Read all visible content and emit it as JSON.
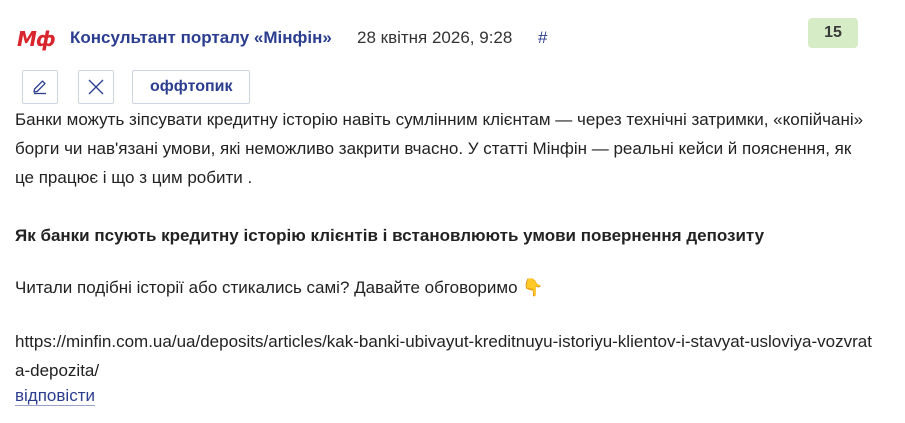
{
  "comment": {
    "logo_text": "Мф",
    "author": "Консультант порталу «Мінфін»",
    "date": "28 квітня 2026, 9:28",
    "anchor": "#",
    "rating": "15",
    "toolbar": {
      "edit_icon": "pencil-icon",
      "close_icon": "close-icon",
      "tag_label": "оффтопик"
    },
    "body": {
      "paragraph1": "Банки можуть зіпсувати кредитну історію навіть сумлінним клієнтам — через технічні затримки, «копійчані» борги чи нав'язані умови, які неможливо закрити вчасно. У статті Мінфін — реальні кейси й пояснення, як це працює і що з цим робити .",
      "heading": "Як банки псують кредитну історію клієнтів і встановлюють умови повернення депозиту",
      "paragraph2": "Читали подібні історії або стикались самі? Давайте обговоримо 👇",
      "link": "https://minfin.com.ua/ua/deposits/articles/kak-banki-ubivayut-kreditnuyu-istoriyu-klientov-i-stavyat-usloviya-vozvrata-depozita/"
    },
    "reply_label": "відповісти"
  },
  "colors": {
    "brand_red": "#d9262e",
    "link_blue": "#2b3d8f",
    "rating_bg": "#d6ecc7"
  }
}
